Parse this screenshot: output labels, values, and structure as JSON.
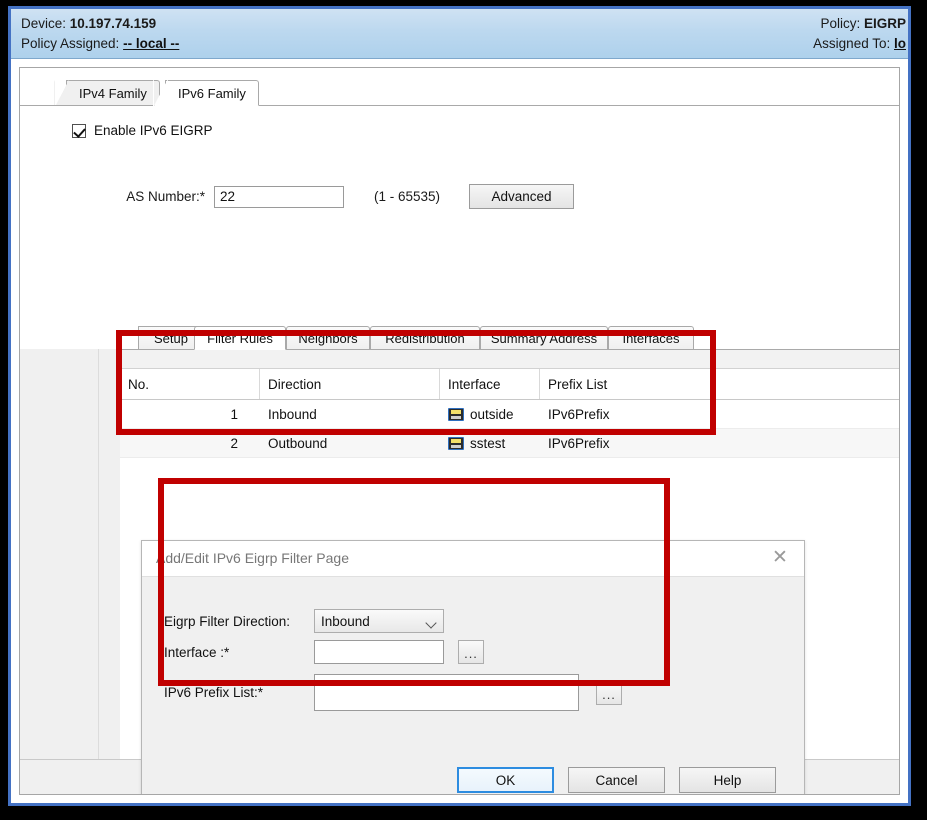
{
  "header": {
    "device_label": "Device:",
    "device_value": "10.197.74.159",
    "policy_assigned_label": "Policy Assigned:",
    "policy_assigned_value": "-- local --",
    "policy_label": "Policy:",
    "policy_value": "EIGRP",
    "assigned_to_label": "Assigned To:",
    "assigned_to_value": "lo"
  },
  "family_tabs": [
    {
      "label": "IPv4 Family",
      "active": false
    },
    {
      "label": "IPv6 Family",
      "active": true
    }
  ],
  "form": {
    "enable_checkbox_label": "Enable IPv6 EIGRP",
    "enable_checked": true,
    "as_number_label": "AS Number:*",
    "as_number_value": "22",
    "as_number_hint": "(1 - 65535)",
    "advanced_button": "Advanced"
  },
  "inner_tabs": [
    {
      "label": "Setup",
      "active": false
    },
    {
      "label": "Filter Rules",
      "active": true
    },
    {
      "label": "Neighbors",
      "active": false
    },
    {
      "label": "Redistribution",
      "active": false
    },
    {
      "label": "Summary Address",
      "active": false
    },
    {
      "label": "Interfaces",
      "active": false
    }
  ],
  "grid": {
    "columns": [
      "No.",
      "Direction",
      "Interface",
      "Prefix List"
    ],
    "rows": [
      {
        "no": "1",
        "direction": "Inbound",
        "interface": "outside",
        "prefix_list": "IPv6Prefix",
        "icon": "network-interface-icon"
      },
      {
        "no": "2",
        "direction": "Outbound",
        "interface": "sstest",
        "prefix_list": "IPv6Prefix",
        "icon": "network-interface-icon"
      }
    ]
  },
  "dialog": {
    "title": "Add/Edit IPv6 Eigrp Filter Page",
    "close_icon": "✕",
    "direction_label": "Eigrp Filter Direction:",
    "direction_value": "Inbound",
    "interface_label": "Interface :*",
    "interface_value": "",
    "interface_browse": "...",
    "prefix_list_label": "IPv6 Prefix List:*",
    "prefix_list_value": "",
    "prefix_list_browse": "...",
    "ok_button": "OK",
    "cancel_button": "Cancel",
    "help_button": "Help"
  },
  "annotations": {
    "accent_color": "#c00000",
    "grid_highlight": "red-highlight-box-grid",
    "dialog_highlight": "red-highlight-box-dialog"
  }
}
